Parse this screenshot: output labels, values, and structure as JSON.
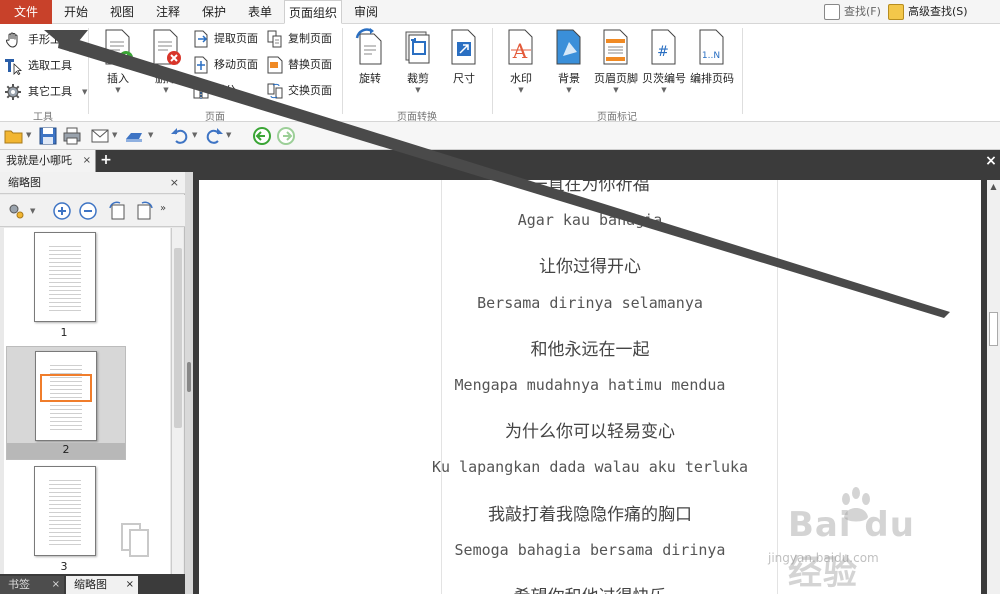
{
  "menu": {
    "tabs": [
      "文件",
      "开始",
      "视图",
      "注释",
      "保护",
      "表单",
      "页面组织",
      "审阅"
    ],
    "search": "查找(F)",
    "advanced_search": "高级查找(S)"
  },
  "ribbon": {
    "tools": {
      "hand": "手形工具",
      "select": "选取工具",
      "other": "其它工具",
      "group": "工具"
    },
    "page": {
      "insert": "插入",
      "delete": "删除",
      "extract": "提取页面",
      "move": "移动页面",
      "split": "拆分",
      "copy": "复制页面",
      "replace": "替换页面",
      "swap": "交换页面",
      "group": "页面"
    },
    "transform": {
      "rotate": "旋转",
      "crop": "裁剪",
      "size": "尺寸",
      "group": "页面转换"
    },
    "marks": {
      "watermark": "水印",
      "background": "背景",
      "header_footer": "页眉页脚",
      "bates": "贝茨编号",
      "page_number": "编排页码",
      "group": "页面标记"
    }
  },
  "doc_tab": {
    "title": "我就是小哪吒",
    "close": "×",
    "add": "+"
  },
  "panel": {
    "title": "缩略图",
    "close": "×",
    "thumbnails": [
      "1",
      "2",
      "3"
    ],
    "selected_index": 2,
    "bottom_tabs": [
      "书签",
      "缩略图"
    ]
  },
  "document": {
    "lines": [
      {
        "text": "一直在为你祈福",
        "lang": "cn"
      },
      {
        "text": "Agar kau bahagia",
        "lang": "lat"
      },
      {
        "text": "让你过得开心",
        "lang": "cn"
      },
      {
        "text": "Bersama dirinya selamanya",
        "lang": "lat"
      },
      {
        "text": "和他永远在一起",
        "lang": "cn"
      },
      {
        "text": "Mengapa mudahnya hatimu mendua",
        "lang": "lat"
      },
      {
        "text": "为什么你可以轻易变心",
        "lang": "cn"
      },
      {
        "text": "Ku lapangkan dada walau aku terluka",
        "lang": "lat"
      },
      {
        "text": "我敲打着我隐隐作痛的胸口",
        "lang": "cn"
      },
      {
        "text": "Semoga bahagia bersama dirinya",
        "lang": "lat"
      },
      {
        "text": "希望你和他过得快乐",
        "lang": "cn"
      }
    ]
  },
  "watermark": {
    "brand": "Bai du 经验",
    "url": "jingyan.baidu.com"
  },
  "colors": {
    "file_tab": "#c8412a",
    "selection_highlight": "#f07d2b",
    "annotation_arrow": "#4a4a4a"
  }
}
